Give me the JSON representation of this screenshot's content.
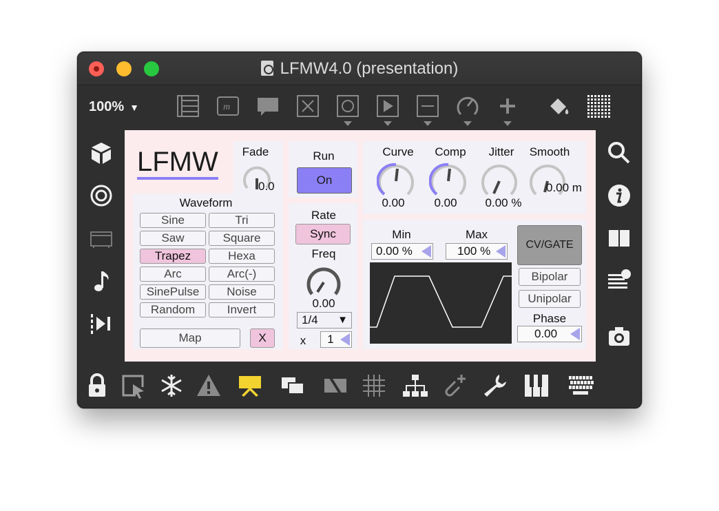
{
  "window": {
    "title": "LFMW4.0 (presentation)"
  },
  "toolbar": {
    "zoom": "100%",
    "icons": [
      "list-icon",
      "message-box-icon",
      "comment-icon",
      "toggle-x-icon",
      "button-icon",
      "play-icon",
      "slider-icon",
      "dial-icon",
      "plus-icon",
      "paint-bucket-icon",
      "grid-icon"
    ]
  },
  "sidebar_left": [
    "cube-icon",
    "target-icon",
    "device-icon",
    "music-note-icon",
    "step-forward-icon"
  ],
  "sidebar_right": [
    "search-icon",
    "info-icon",
    "columns-icon",
    "list-record-icon",
    "camera-icon"
  ],
  "bottombar": [
    "lock-icon",
    "select-icon",
    "freeze-icon",
    "warning-icon",
    "presentation-icon",
    "windows-icon",
    "mute-icon",
    "grid-snap-icon",
    "hierarchy-icon",
    "paperclip-add-icon",
    "wrench-icon",
    "piano-icon",
    "keyboard-icon"
  ],
  "device": {
    "logo": "LFMW",
    "fade": {
      "label": "Fade",
      "value": "0.0"
    },
    "waveform": {
      "label": "Waveform",
      "options": [
        "Sine",
        "Tri",
        "Saw",
        "Square",
        "Trapez",
        "Hexa",
        "Arc",
        "Arc(-)",
        "SinePulse",
        "Noise",
        "Random",
        "Invert"
      ],
      "selected": "Trapez"
    },
    "map_label": "Map",
    "clear_label": "X",
    "run": {
      "label": "Run",
      "button": "On"
    },
    "rate": {
      "label": "Rate",
      "sync": "Sync",
      "freq_label": "Freq",
      "freq_value": "0.00",
      "division": "1/4",
      "mult_label": "x",
      "mult_value": "1"
    },
    "knobs": [
      {
        "label": "Curve",
        "value": "0.00"
      },
      {
        "label": "Comp",
        "value": "0.00"
      },
      {
        "label": "Jitter",
        "value": "0.00 %"
      },
      {
        "label": "Smooth",
        "value": "0.00 m"
      }
    ],
    "min": {
      "label": "Min",
      "value": "0.00 %"
    },
    "max": {
      "label": "Max",
      "value": "100 %"
    },
    "cvgate": "CV/GATE",
    "bipolar": "Bipolar",
    "unipolar": "Unipolar",
    "phase": {
      "label": "Phase",
      "value": "0.00"
    },
    "colors": {
      "accent": "#8b7ff5",
      "panel": "#fcecee",
      "box": "#f2f1f7",
      "selected": "#f0c4dd",
      "cvgate": "#9b9b9b"
    }
  }
}
